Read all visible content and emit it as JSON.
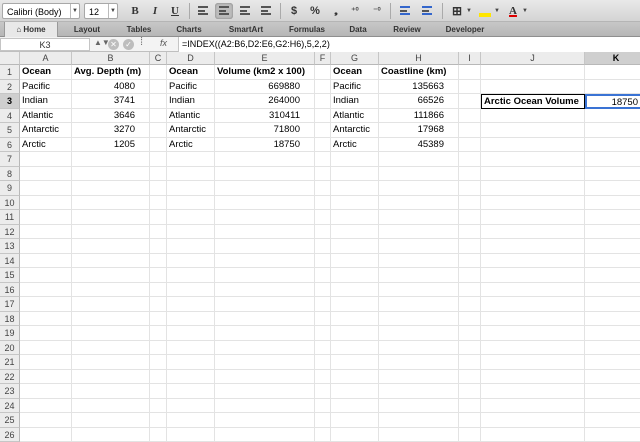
{
  "toolbar": {
    "font_name": "Calibri (Body)",
    "font_size": "12",
    "bold_label": "B",
    "italic_label": "I",
    "underline_label": "U",
    "currency_label": "$",
    "percent_label": "%",
    "font_color_label": "A"
  },
  "ribbon": {
    "tabs": [
      {
        "label": "Home",
        "icon": "home-icon",
        "active": true
      },
      {
        "label": "Layout"
      },
      {
        "label": "Tables"
      },
      {
        "label": "Charts"
      },
      {
        "label": "SmartArt"
      },
      {
        "label": "Formulas"
      },
      {
        "label": "Data"
      },
      {
        "label": "Review"
      },
      {
        "label": "Developer"
      }
    ]
  },
  "formula_bar": {
    "name_box": "K3",
    "fx_label": "fx",
    "formula": "=INDEX((A2:B6,D2:E6,G2:H6),5,2,2)"
  },
  "sheet": {
    "columns": [
      "A",
      "B",
      "C",
      "D",
      "E",
      "F",
      "G",
      "H",
      "I",
      "J",
      "K"
    ],
    "selected_column": "K",
    "selected_row": 3,
    "row_count": 26,
    "cells": {
      "A1": "Ocean",
      "B1": "Avg. Depth (m)",
      "D1": "Ocean",
      "E1": "Volume (km2 x 100)",
      "G1": "Ocean",
      "H1": "Coastline (km)",
      "A2": "Pacific",
      "B2": "4080",
      "D2": "Pacific",
      "E2": "669880",
      "G2": "Pacific",
      "H2": "135663",
      "A3": "Indian",
      "B3": "3741",
      "D3": "Indian",
      "E3": "264000",
      "G3": "Indian",
      "H3": "66526",
      "A4": "Atlantic",
      "B4": "3646",
      "D4": "Atlantic",
      "E4": "310411",
      "G4": "Atlantic",
      "H4": "111866",
      "A5": "Antarctic",
      "B5": "3270",
      "D5": "Antarctic",
      "E5": "71800",
      "G5": "Antarctic",
      "H5": "17968",
      "A6": "Arctic",
      "B6": "1205",
      "D6": "Arctic",
      "E6": "18750",
      "G6": "Arctic",
      "H6": "45389",
      "J3": "Arctic Ocean Volume",
      "K3": "18750"
    }
  }
}
